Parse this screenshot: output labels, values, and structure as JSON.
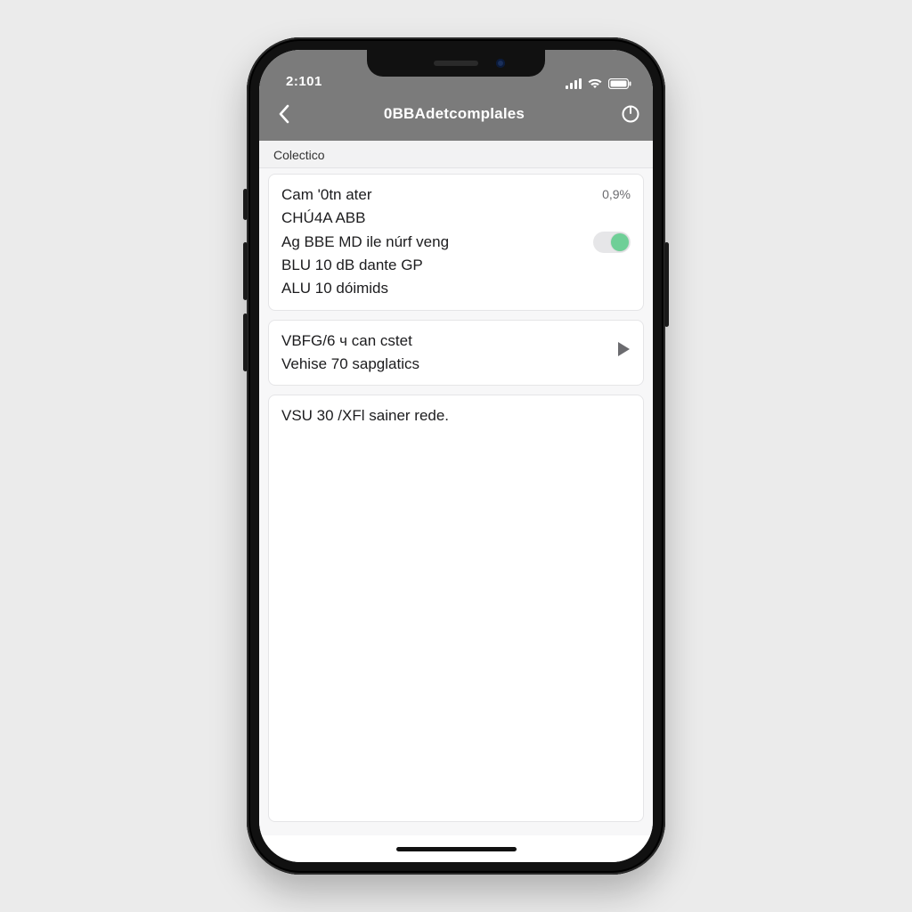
{
  "statusbar": {
    "time": "2:101"
  },
  "navbar": {
    "title": "0BBAdetcomplales"
  },
  "section": {
    "header": "Colectico"
  },
  "card1": {
    "row0_label": "Cam '0tn ater",
    "row0_value": "0,9%",
    "line1": "CHÚ4A ABB",
    "row2_label": "Ag BBE MD ile núrf veng",
    "line3": "BLU 10 dB dante GP",
    "line4": "ALU 10 dóimids"
  },
  "card2": {
    "line0": "VBFG/6 ч can cstet",
    "line1": "Vehise 70 sapglatics"
  },
  "card3": {
    "line0": "VSU 30 /XFl sainer rede."
  }
}
